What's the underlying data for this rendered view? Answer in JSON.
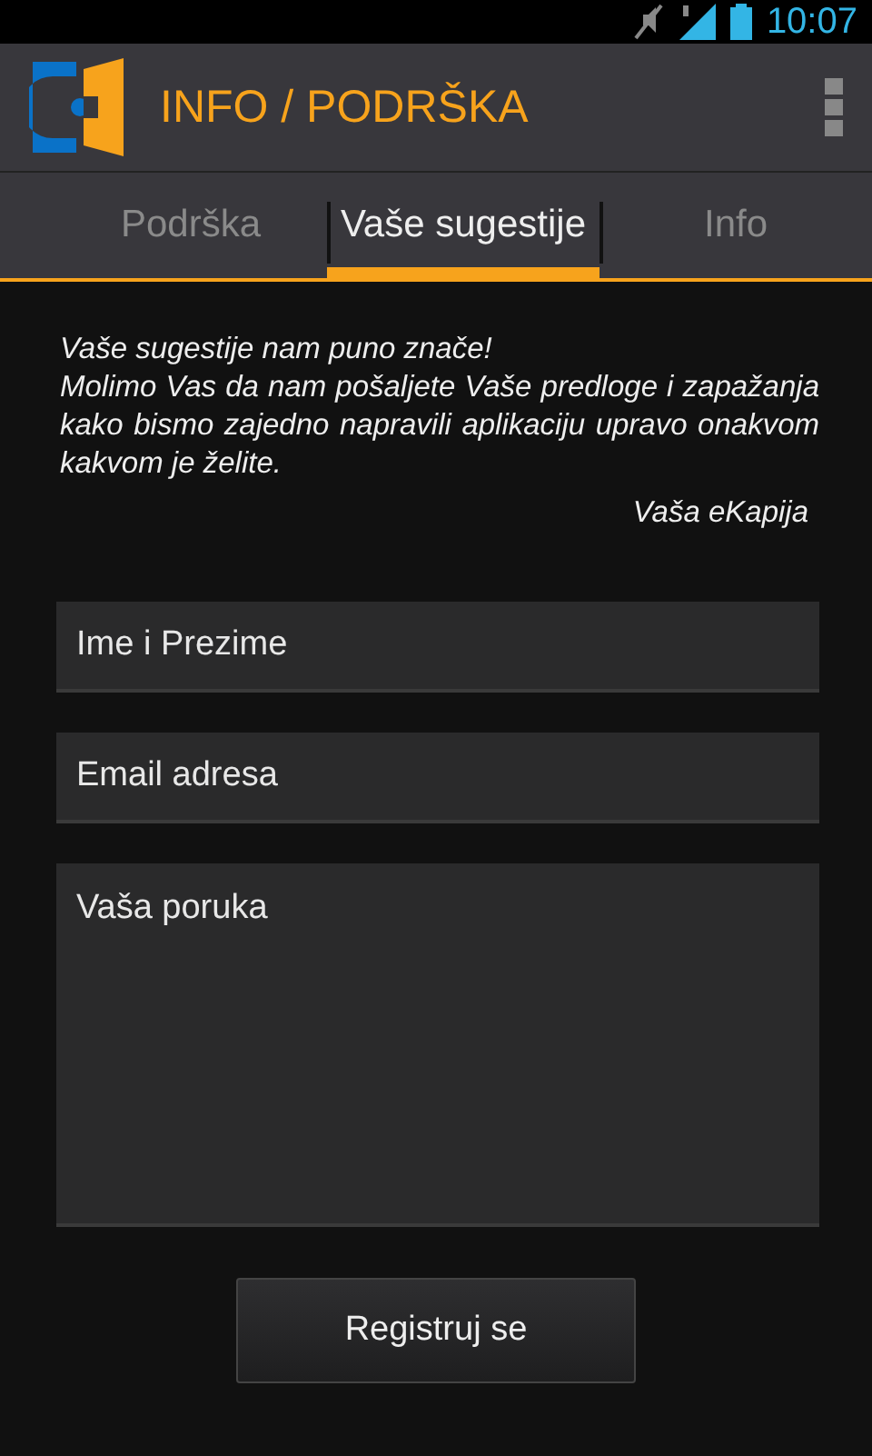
{
  "status_bar": {
    "time": "10:07"
  },
  "app_bar": {
    "title": "INFO / PODRŠKA"
  },
  "tabs": [
    {
      "label": "Podrška",
      "selected": false
    },
    {
      "label": "Vaše sugestije",
      "selected": true
    },
    {
      "label": "Info",
      "selected": false
    }
  ],
  "intro": {
    "heading": "Vaše sugestije nam puno znače!",
    "body": "Molimo Vas da nam pošaljete Vaše predloge i zapažanja kako bismo zajedno napravili aplikaciju upravo onakvom kakvom je želite.",
    "signature": "Vaša eKapija"
  },
  "form": {
    "fields": [
      {
        "kind": "line",
        "placeholder": "Ime i Prezime"
      },
      {
        "kind": "line",
        "placeholder": "Email adresa"
      },
      {
        "kind": "area",
        "placeholder": "Vaša poruka"
      }
    ],
    "submit": "Registruj se"
  }
}
